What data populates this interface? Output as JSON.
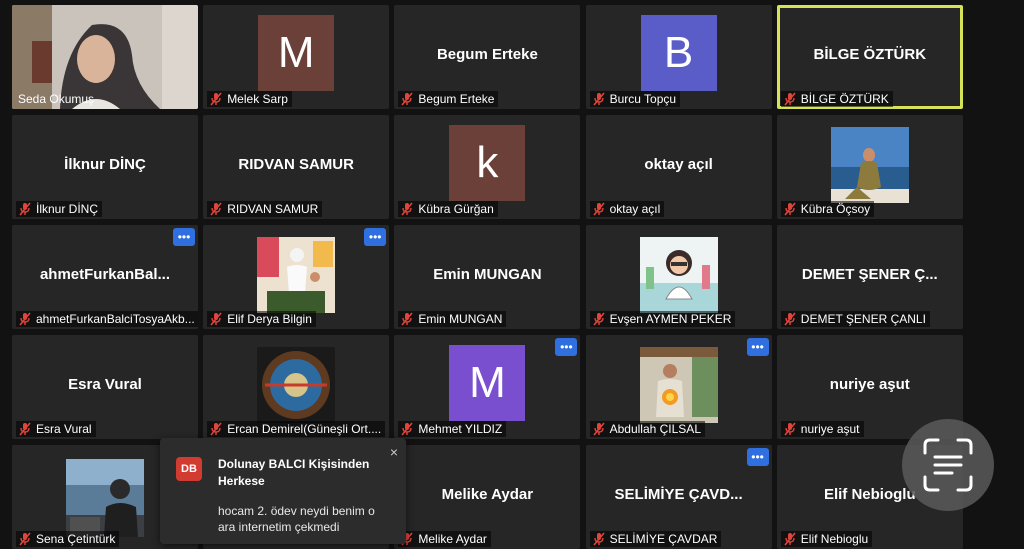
{
  "tiles": [
    {
      "name": "Seda Okumuş",
      "display": "photo",
      "photo": "woman-headscarf",
      "label_plain": true
    },
    {
      "name": "Melek Sarp",
      "display": "avatar",
      "avatar_letter": "M",
      "avatar_color": "#6b4038"
    },
    {
      "name": "Begum Erteke",
      "display": "name"
    },
    {
      "name": "Burcu Topçu",
      "display": "avatar",
      "avatar_letter": "B",
      "avatar_color": "#5a5cc8"
    },
    {
      "name": "BİLGE ÖZTÜRK",
      "display": "name",
      "active": true
    },
    {
      "name": "İlknur DİNÇ",
      "display": "name"
    },
    {
      "name": "RIDVAN SAMUR",
      "display": "name"
    },
    {
      "name": "Kübra Gürğan",
      "display": "avatar",
      "avatar_letter": "k",
      "avatar_color": "#6b4038"
    },
    {
      "name": "oktay açıl",
      "display": "name"
    },
    {
      "name": "Kübra Öçsoy",
      "display": "photo",
      "photo": "seaside-woman"
    },
    {
      "center": "ahmetFurkanBal...",
      "name": "ahmetFurkanBalciTosyaAkb...",
      "display": "name",
      "more": true
    },
    {
      "name": "Elif Derya Bilgin",
      "display": "photo",
      "photo": "classroom",
      "more": true
    },
    {
      "name": "Emin MUNGAN",
      "display": "name"
    },
    {
      "name": "Evşen AYMEN PEKER",
      "display": "photo",
      "photo": "cartoon-scientist"
    },
    {
      "center": "DEMET ŞENER Ç...",
      "name": "DEMET ŞENER ÇANLI",
      "display": "name"
    },
    {
      "name": "Esra Vural",
      "display": "name"
    },
    {
      "name": "Ercan Demirel(Güneşli Ort....",
      "display": "photo",
      "photo": "eye-logo"
    },
    {
      "name": "Mehmet YILDIZ",
      "display": "avatar",
      "avatar_letter": "M",
      "avatar_color": "#7a4fcf",
      "more": true
    },
    {
      "name": "Abdullah ÇILSAL",
      "display": "photo",
      "photo": "man-fire",
      "more": true
    },
    {
      "name": "nuriye aşut",
      "display": "name"
    },
    {
      "name": "Sena Çetintürk",
      "display": "photo",
      "photo": "person-sea"
    },
    {
      "name": "",
      "display": "hidden"
    },
    {
      "name": "Melike Aydar",
      "display": "name"
    },
    {
      "center": "SELİMİYE ÇAVD...",
      "name": "SELİMİYE ÇAVDAR",
      "display": "name",
      "more": true
    },
    {
      "name": "Elif Nebioglu",
      "display": "name"
    }
  ],
  "more_glyph": "•••",
  "toast": {
    "initials": "DB",
    "title": "Dolunay BALCI Kişisinden Herkese",
    "message": "hocam 2. ödev neydi benim o ara internetim çekmedi",
    "close": "×"
  },
  "colors": {
    "active_border": "#d6e359",
    "muted_mic": "#e0453b",
    "more_button": "#2f6fe0"
  }
}
